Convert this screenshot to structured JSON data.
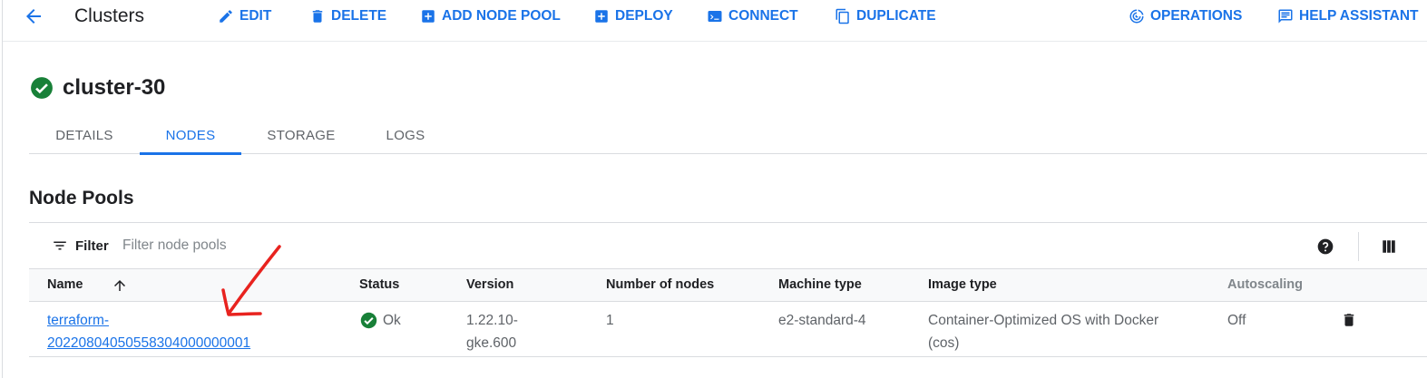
{
  "header": {
    "title": "Clusters",
    "actions": {
      "edit": "EDIT",
      "delete": "DELETE",
      "add_node_pool": "ADD NODE POOL",
      "deploy": "DEPLOY",
      "connect": "CONNECT",
      "duplicate": "DUPLICATE",
      "operations": "OPERATIONS",
      "help_assistant": "HELP ASSISTANT"
    }
  },
  "cluster": {
    "name": "cluster-30",
    "status_icon": "check-circle-icon"
  },
  "tabs": [
    {
      "label": "DETAILS",
      "active": false
    },
    {
      "label": "NODES",
      "active": true
    },
    {
      "label": "STORAGE",
      "active": false
    },
    {
      "label": "LOGS",
      "active": false
    }
  ],
  "node_pools": {
    "title": "Node Pools",
    "filter": {
      "label": "Filter",
      "placeholder": "Filter node pools",
      "value": ""
    },
    "columns": {
      "name": "Name",
      "status": "Status",
      "version": "Version",
      "nodes": "Number of nodes",
      "machine_type": "Machine type",
      "image_type": "Image type",
      "autoscaling": "Autoscaling"
    },
    "sort": {
      "column": "Name",
      "direction": "ascending"
    },
    "rows": [
      {
        "name_line1": "terraform-",
        "name_line2": "20220804050558304000000001",
        "status": "Ok",
        "version_line1": "1.22.10-",
        "version_line2": "gke.600",
        "nodes": "1",
        "machine_type": "e2-standard-4",
        "image_type_line1": "Container-Optimized OS with Docker",
        "image_type_line2": "(cos)",
        "autoscaling": "Off"
      }
    ]
  },
  "colors": {
    "accent": "#1a73e8",
    "success": "#188038",
    "annotation": "#e8231f",
    "text": "#202124",
    "muted_text": "#5f6368"
  }
}
